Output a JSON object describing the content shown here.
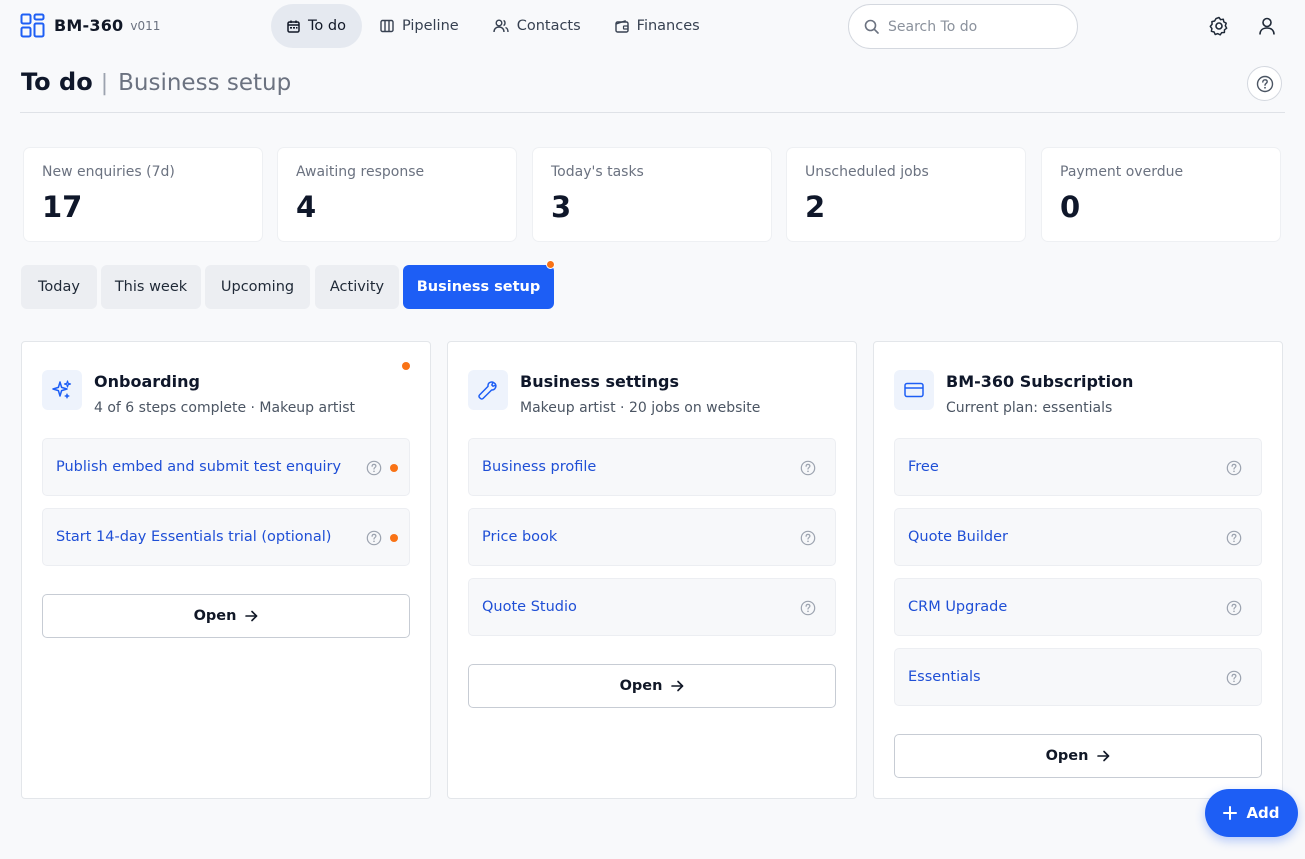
{
  "brand": {
    "name": "BM-360",
    "version": "v011"
  },
  "nav": {
    "items": [
      {
        "label": "To do",
        "icon": "calendar-icon",
        "active": true
      },
      {
        "label": "Pipeline",
        "icon": "columns-icon"
      },
      {
        "label": "Contacts",
        "icon": "users-icon"
      },
      {
        "label": "Finances",
        "icon": "wallet-icon"
      }
    ]
  },
  "search": {
    "placeholder": "Search To do",
    "value": ""
  },
  "header": {
    "title": "To do",
    "separator": "|",
    "subtitle": "Business setup"
  },
  "stats": [
    {
      "label": "New enquiries (7d)",
      "value": "17"
    },
    {
      "label": "Awaiting response",
      "value": "4"
    },
    {
      "label": "Today's tasks",
      "value": "3"
    },
    {
      "label": "Unscheduled jobs",
      "value": "2"
    },
    {
      "label": "Payment overdue",
      "value": "0"
    }
  ],
  "tabs": [
    {
      "label": "Today"
    },
    {
      "label": "This week"
    },
    {
      "label": "Upcoming"
    },
    {
      "label": "Activity"
    },
    {
      "label": "Business setup",
      "active": true,
      "has_dot": true
    }
  ],
  "cards": [
    {
      "title": "Onboarding",
      "subtitle": "4 of 6 steps complete · Makeup artist",
      "icon": "sparkles-icon",
      "has_dot": true,
      "items": [
        {
          "label": "Publish embed and submit test enquiry",
          "has_dot": true
        },
        {
          "label": "Start 14-day Essentials trial (optional)",
          "has_dot": true
        }
      ],
      "open_label": "Open"
    },
    {
      "title": "Business settings",
      "subtitle": "Makeup artist · 20 jobs on website",
      "icon": "wrench-icon",
      "items": [
        {
          "label": "Business profile"
        },
        {
          "label": "Price book"
        },
        {
          "label": "Quote Studio"
        }
      ],
      "open_label": "Open"
    },
    {
      "title": "BM-360 Subscription",
      "subtitle": "Current plan: essentials",
      "icon": "credit-card-icon",
      "items": [
        {
          "label": "Free"
        },
        {
          "label": "Quote Builder"
        },
        {
          "label": "CRM Upgrade"
        },
        {
          "label": "Essentials"
        }
      ],
      "open_label": "Open"
    }
  ],
  "fab": {
    "label": "Add"
  },
  "colors": {
    "accent": "#1d5ef5",
    "notification": "#f97316",
    "link": "#1f4fd6"
  }
}
